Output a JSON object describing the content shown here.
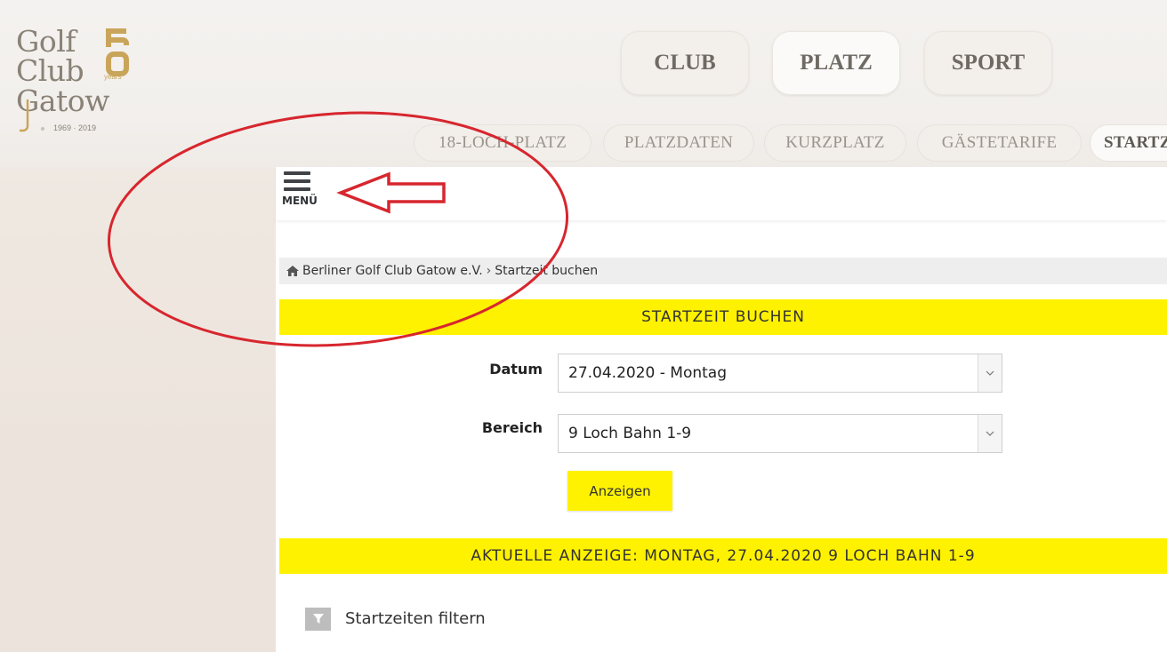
{
  "logo": {
    "line1": "Golf",
    "line2": "Club",
    "line3": "Gatow",
    "years_label": "years",
    "dates": "1969 · 2019",
    "badge": "50"
  },
  "main_nav": {
    "club": "CLUB",
    "platz": "PLATZ",
    "sport": "SPORT"
  },
  "sub_nav": [
    {
      "label": "18-LOCH-PLATZ"
    },
    {
      "label": "PLATZDATEN"
    },
    {
      "label": "KURZPLATZ"
    },
    {
      "label": "GÄSTETARIFE"
    },
    {
      "label": "STARTZEITEN"
    }
  ],
  "menu": {
    "label": "MENÜ"
  },
  "breadcrumb": {
    "home": "Berliner Golf Club Gatow e.V.",
    "separator": "›",
    "current": "Startzeit buchen"
  },
  "header1": "STARTZEIT BUCHEN",
  "form": {
    "datum_label": "Datum",
    "datum_value": "27.04.2020 - Montag",
    "bereich_label": "Bereich",
    "bereich_value": "9 Loch Bahn 1-9",
    "show_button": "Anzeigen"
  },
  "header2": "AKTUELLE ANZEIGE: MONTAG, 27.04.2020 9 LOCH BAHN 1-9",
  "filter": {
    "label": "Startzeiten filtern"
  },
  "colors": {
    "accent_yellow": "#fff200",
    "annotation_red": "#d7262e",
    "logo_gold": "#c9a55a"
  }
}
